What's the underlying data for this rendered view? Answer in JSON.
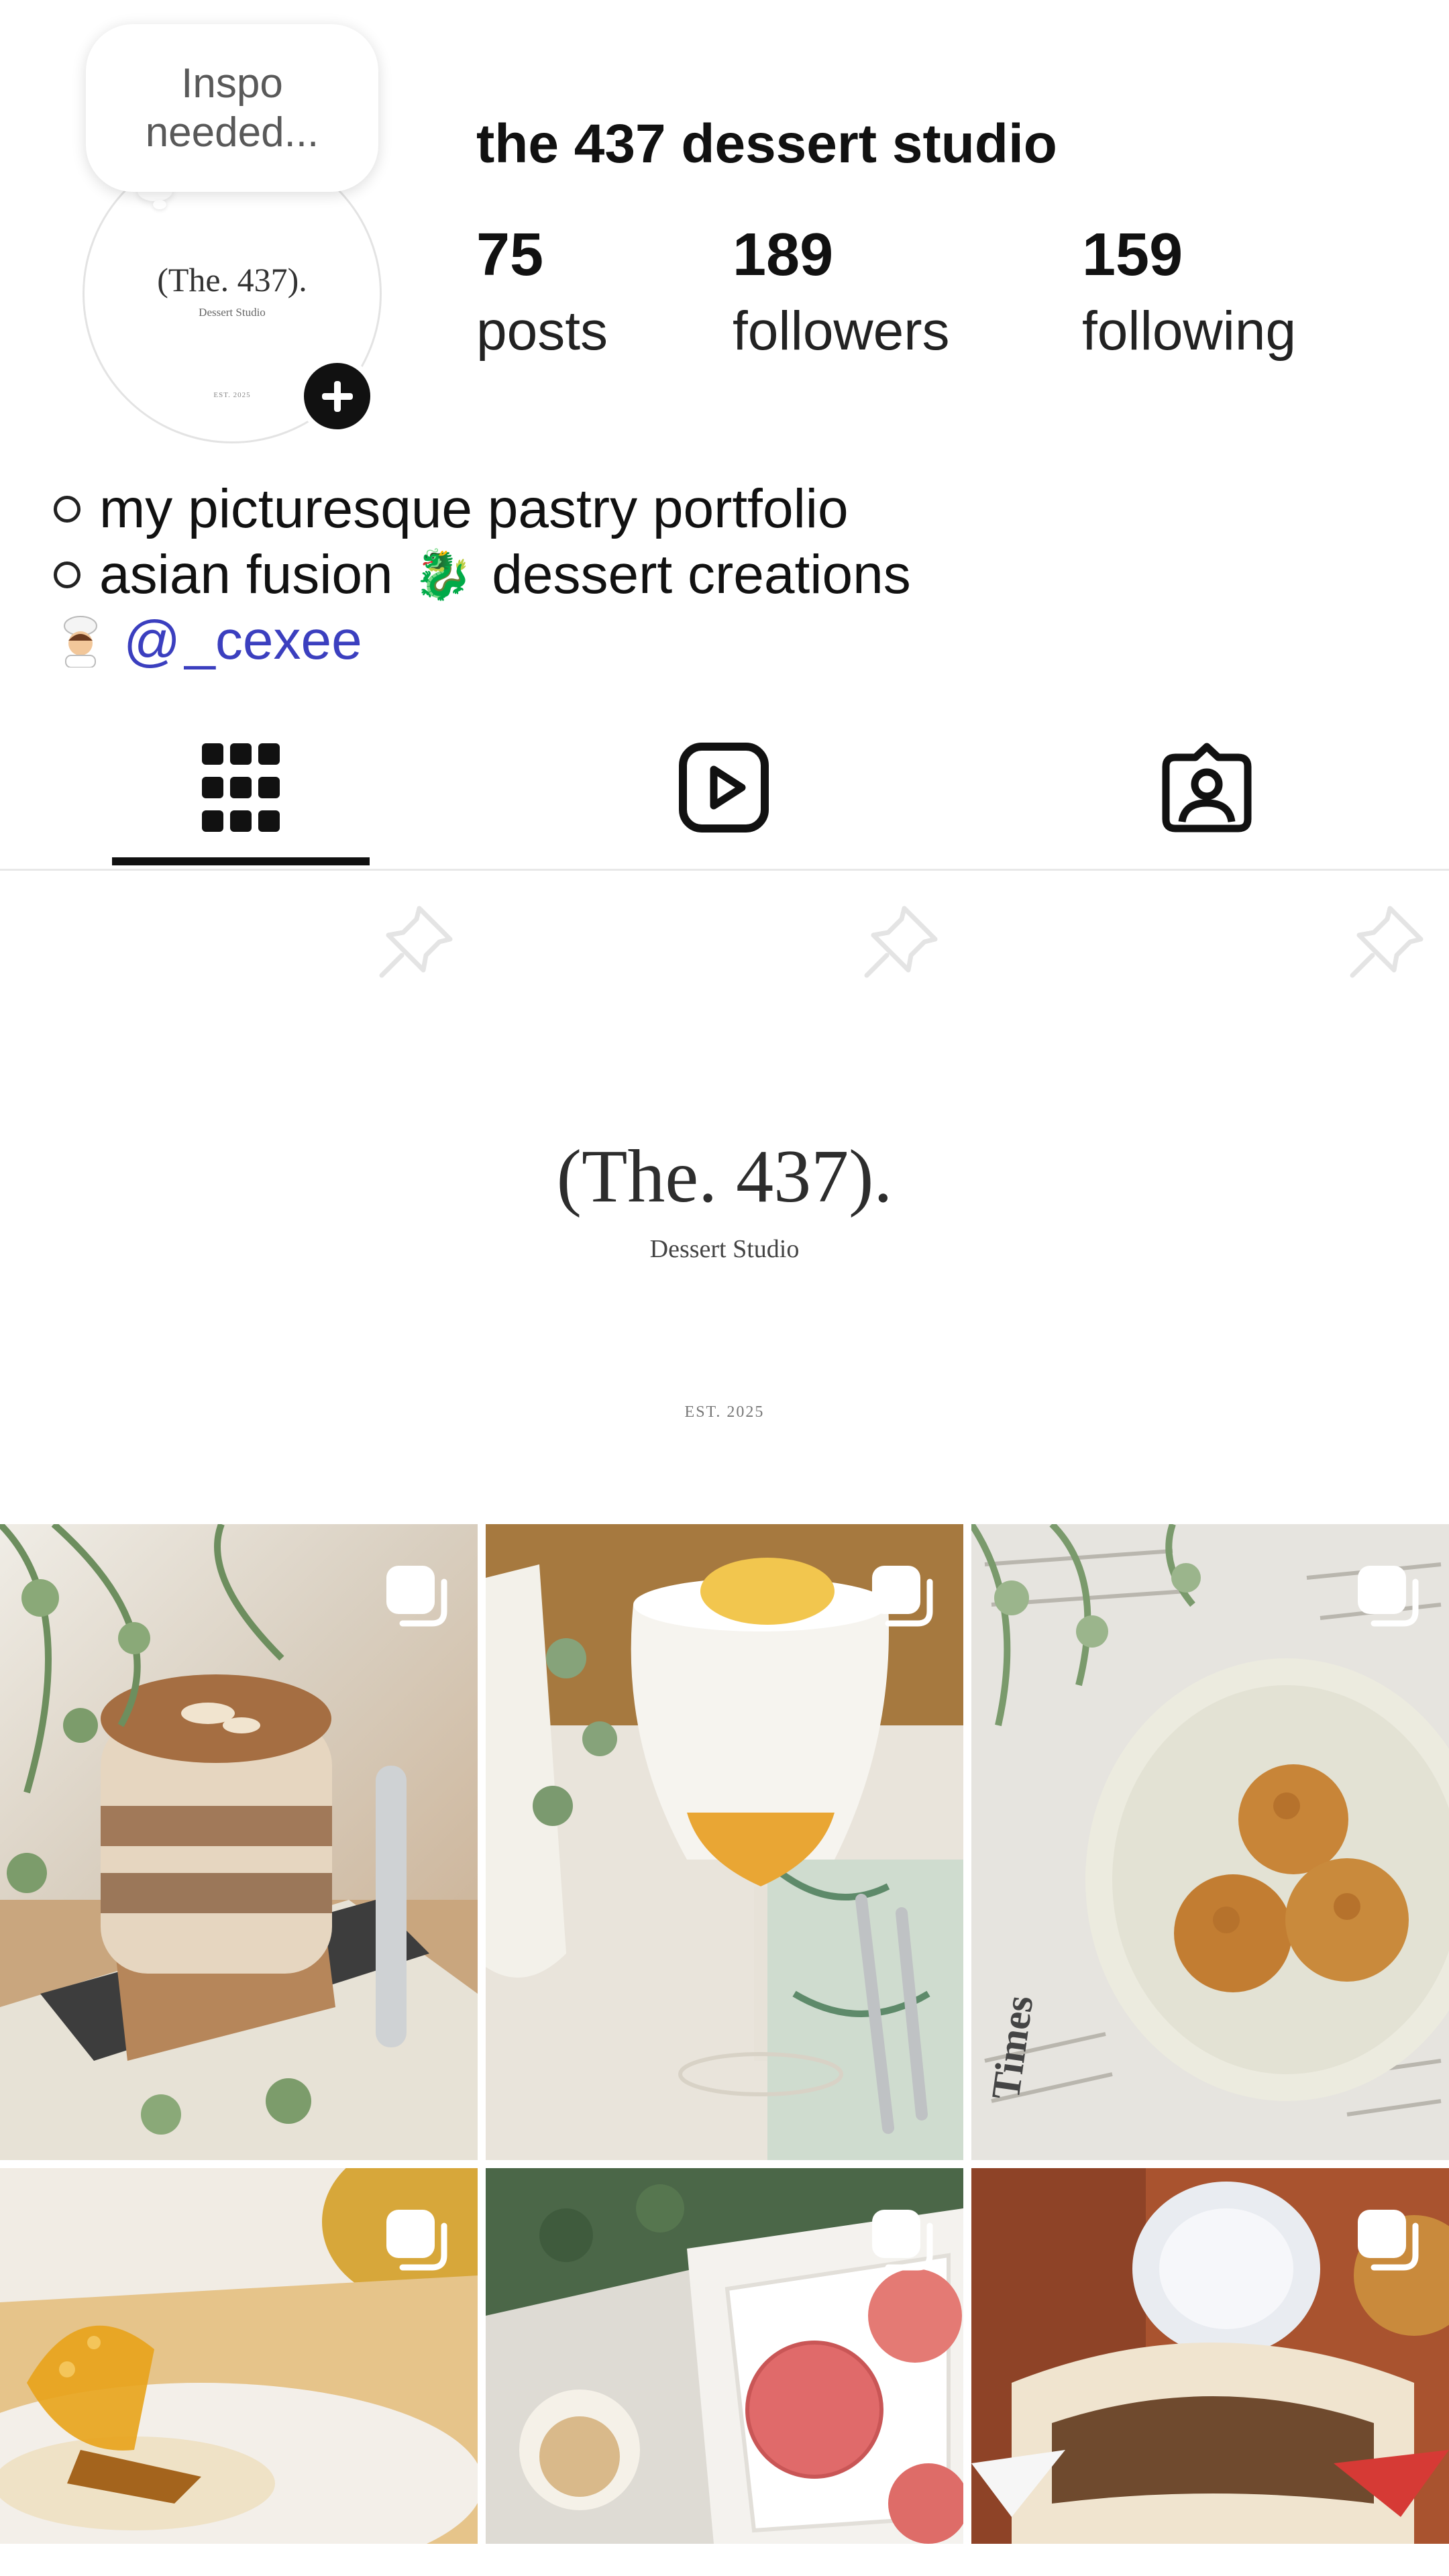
{
  "profile": {
    "note": "Inspo needed...",
    "name": "the 437 dessert studio",
    "avatar_logo": {
      "title": "(The. 437).",
      "subtitle": "Dessert Studio",
      "est": "EST. 2025"
    }
  },
  "stats": [
    {
      "value": "75",
      "label": "posts"
    },
    {
      "value": "189",
      "label": "followers"
    },
    {
      "value": "159",
      "label": "following"
    }
  ],
  "bio": {
    "line1": "my picturesque pastry portfolio",
    "line2_a": "asian fusion",
    "line2_emoji": "🐉",
    "line2_b": "dessert creations",
    "threads_handle": "_cexee"
  },
  "tabs": [
    {
      "name": "posts-grid",
      "icon": "grid-icon",
      "active": true
    },
    {
      "name": "reels",
      "icon": "reels-icon",
      "active": false
    },
    {
      "name": "tagged",
      "icon": "tagged-icon",
      "active": false
    }
  ],
  "pinned_banner": {
    "title": "(The. 437).",
    "subtitle": "Dessert Studio",
    "est": "EST. 2025"
  },
  "posts": [
    {
      "subject": "tiramisu cup",
      "multi": true
    },
    {
      "subject": "layered drink with egg topping",
      "multi": true
    },
    {
      "subject": "cream puffs on newspaper",
      "multi": true
    },
    {
      "subject": "tart with sugar shard",
      "multi": true
    },
    {
      "subject": "pink truffles in tray",
      "multi": true
    },
    {
      "subject": "mochi with cream",
      "multi": true
    }
  ],
  "colors": {
    "text": "#111111",
    "link": "#3b3fbf",
    "divider": "#e8e8e8"
  }
}
